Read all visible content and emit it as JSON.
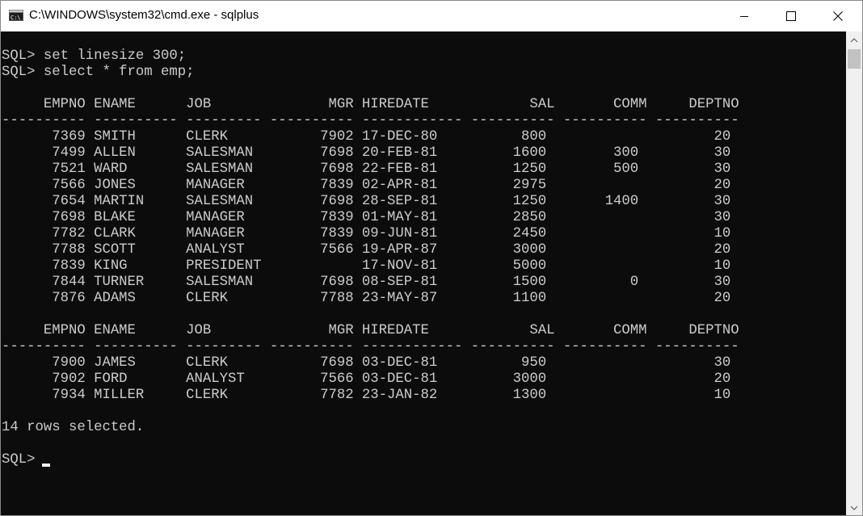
{
  "window": {
    "title": "C:\\WINDOWS\\system32\\cmd.exe - sqlplus",
    "minimize_icon": "minimize-icon",
    "maximize_icon": "maximize-icon",
    "close_icon": "close-icon"
  },
  "console": {
    "lines": [
      "SQL> set linesize 300;",
      "SQL> select * from emp;",
      "",
      "     EMPNO ENAME      JOB              MGR HIREDATE            SAL       COMM     DEPTNO",
      "---------- ---------- --------- ---------- ------------ ---------- ---------- ----------",
      "      7369 SMITH      CLERK           7902 17-DEC-80          800                    20",
      "      7499 ALLEN      SALESMAN        7698 20-FEB-81         1600        300         30",
      "      7521 WARD       SALESMAN        7698 22-FEB-81         1250        500         30",
      "      7566 JONES      MANAGER         7839 02-APR-81         2975                    20",
      "      7654 MARTIN     SALESMAN        7698 28-SEP-81         1250       1400         30",
      "      7698 BLAKE      MANAGER         7839 01-MAY-81         2850                    30",
      "      7782 CLARK      MANAGER         7839 09-JUN-81         2450                    10",
      "      7788 SCOTT      ANALYST         7566 19-APR-87         3000                    20",
      "      7839 KING       PRESIDENT            17-NOV-81         5000                    10",
      "      7844 TURNER     SALESMAN        7698 08-SEP-81         1500          0         30",
      "      7876 ADAMS      CLERK           7788 23-MAY-87         1100                    20",
      "",
      "     EMPNO ENAME      JOB              MGR HIREDATE            SAL       COMM     DEPTNO",
      "---------- ---------- --------- ---------- ------------ ---------- ---------- ----------",
      "      7900 JAMES      CLERK           7698 03-DEC-81          950                    30",
      "      7902 FORD       ANALYST         7566 03-DEC-81         3000                    20",
      "      7934 MILLER     CLERK           7782 23-JAN-82         1300                    10",
      "",
      "14 rows selected.",
      "",
      "SQL> "
    ],
    "background_color": "#0c0c0c",
    "text_color": "#cccccc"
  },
  "scrollbar": {
    "up_icon": "scroll-up-arrow-icon",
    "down_icon": "scroll-down-arrow-icon"
  }
}
